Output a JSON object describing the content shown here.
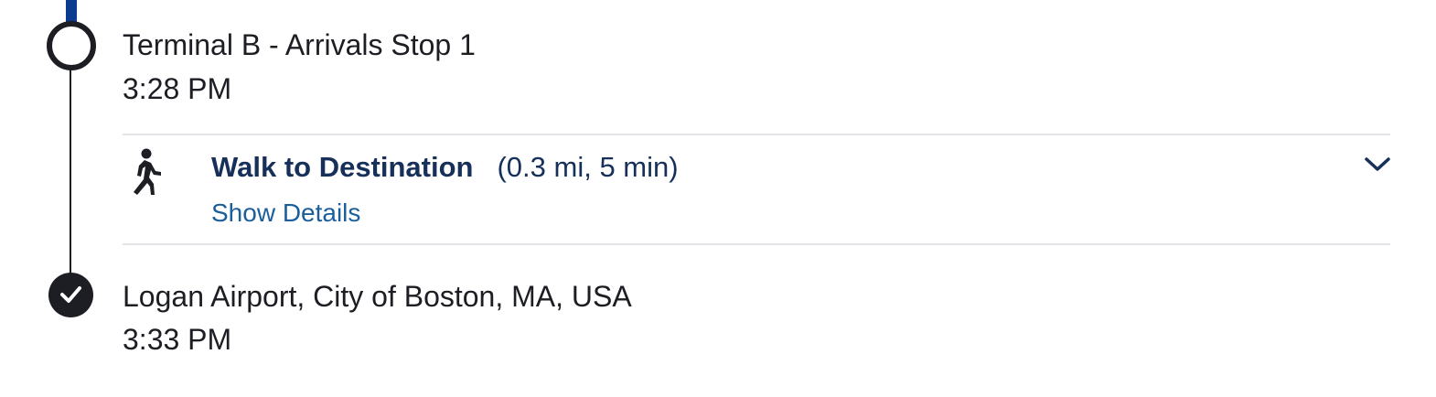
{
  "colors": {
    "route_line": "#0b3b8f",
    "text_primary": "#1c1e23",
    "leg_title": "#16305a",
    "link": "#1a5e9c",
    "divider": "#e2e4e8"
  },
  "itinerary": {
    "stops": [
      {
        "name": "Terminal B - Arrivals Stop 1",
        "time": "3:28 PM",
        "marker": "open-circle"
      },
      {
        "name": "Logan Airport, City of Boston, MA, USA",
        "time": "3:33 PM",
        "marker": "check-circle"
      }
    ],
    "walk_leg": {
      "icon": "walking-person-icon",
      "mode_label": "Walk to Destination",
      "summary": "(0.3 mi, 5 min)",
      "details_link": "Show Details",
      "expand_icon": "chevron-down-icon"
    }
  }
}
